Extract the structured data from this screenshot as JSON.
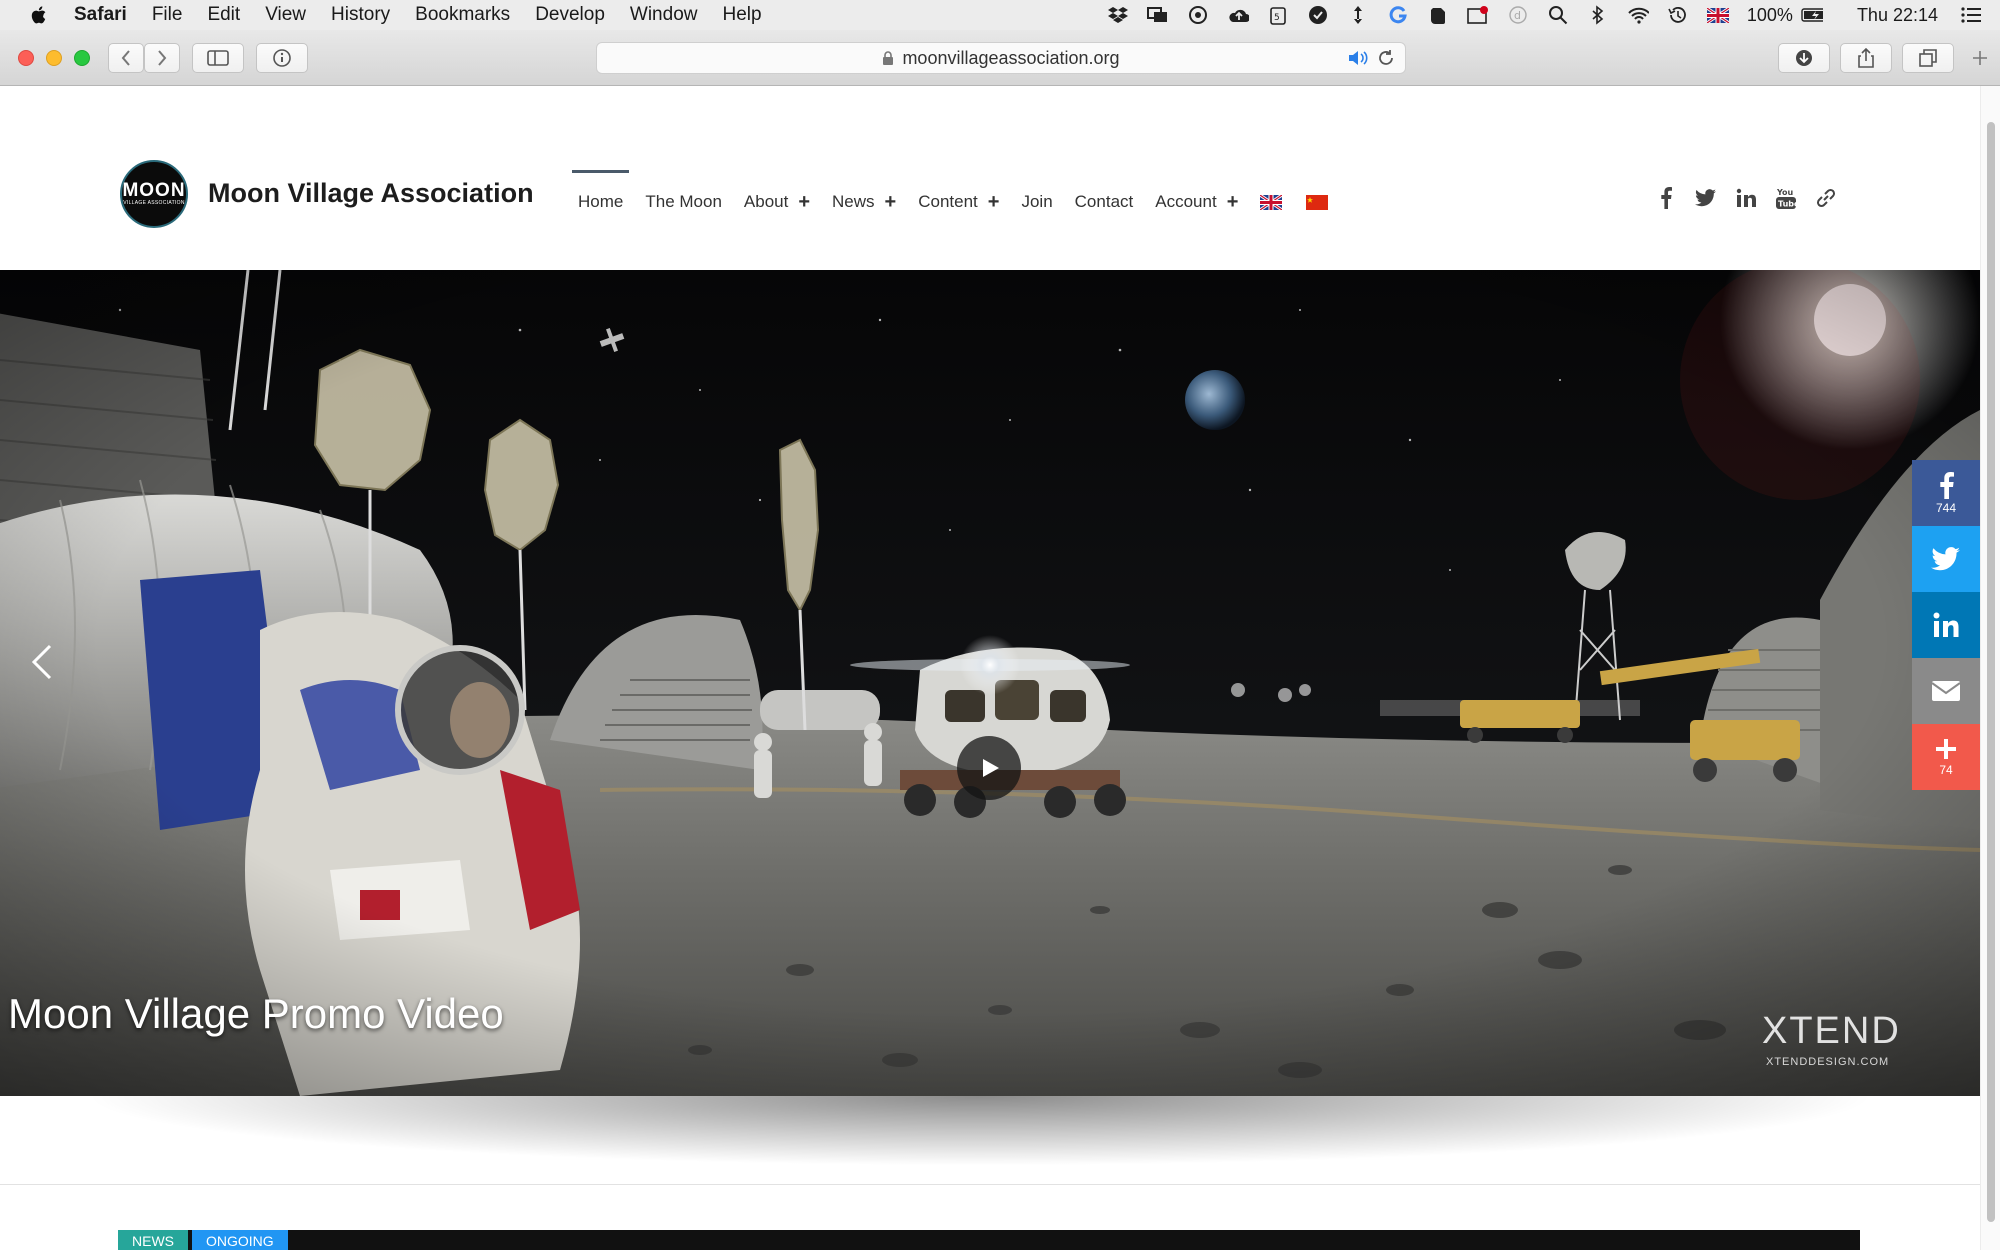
{
  "menubar": {
    "app": "Safari",
    "items": [
      "File",
      "Edit",
      "View",
      "History",
      "Bookmarks",
      "Develop",
      "Window",
      "Help"
    ],
    "battery": "100%",
    "clock": "Thu 22:14"
  },
  "browser": {
    "url": "moonvillageassociation.org"
  },
  "site": {
    "logo_text": "MOON",
    "logo_sub": "VILLAGE ASSOCIATION",
    "name": "Moon Village Association",
    "nav": {
      "home": "Home",
      "moon": "The Moon",
      "about": "About",
      "news": "News",
      "content": "Content",
      "join": "Join",
      "contact": "Contact",
      "account": "Account"
    }
  },
  "hero": {
    "title": "Moon Village Promo Video",
    "watermark": "XTEND",
    "watermark_sub": "XTENDDESIGN.COM"
  },
  "share": {
    "facebook_count": "744",
    "more_count": "74"
  },
  "ticker": {
    "tag1": "NEWS",
    "tag2": "ONGOING"
  },
  "colors": {
    "facebook": "#3b5998",
    "twitter": "#1da1f2",
    "linkedin": "#0077b5",
    "email": "#8a8a8a",
    "more": "#f2594b",
    "tag_news": "#26a69a",
    "tag_ongoing": "#2196f3"
  }
}
